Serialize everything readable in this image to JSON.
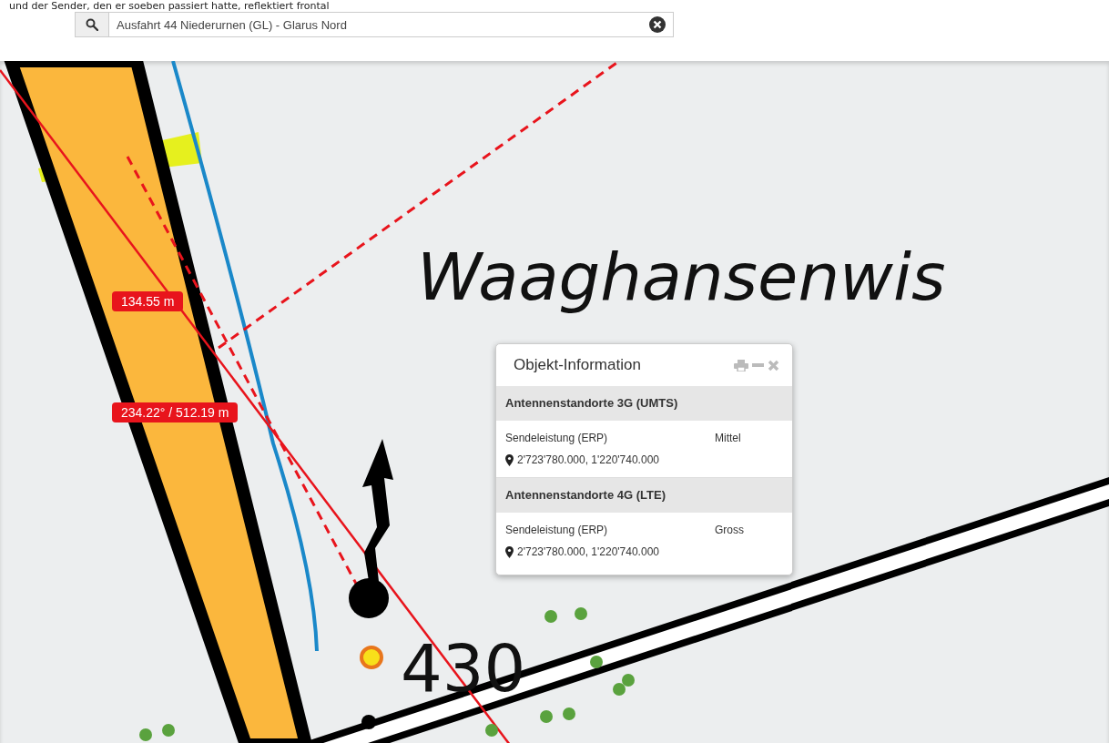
{
  "caption": "und der Sender, den er soeben passiert hatte, reflektiert frontal",
  "search": {
    "value": "Ausfahrt 44 Niederurnen (GL) - Glarus Nord"
  },
  "map": {
    "labels": [
      {
        "kind": "place",
        "text": "Waaghansenwis"
      },
      {
        "kind": "elevation",
        "text": "430"
      }
    ],
    "measurements": [
      "134.55 m",
      "234.22° / 512.19 m"
    ]
  },
  "popup": {
    "title": "Objekt-Information",
    "sections": [
      {
        "heading": "Antennenstandorte 3G (UMTS)",
        "field": "Sendeleistung (ERP)",
        "value": "Mittel",
        "coordinates": "2'723'780.000, 1'220'740.000"
      },
      {
        "heading": "Antennenstandorte 4G (LTE)",
        "field": "Sendeleistung (ERP)",
        "value": "Gross",
        "coordinates": "2'723'780.000, 1'220'740.000"
      }
    ]
  }
}
